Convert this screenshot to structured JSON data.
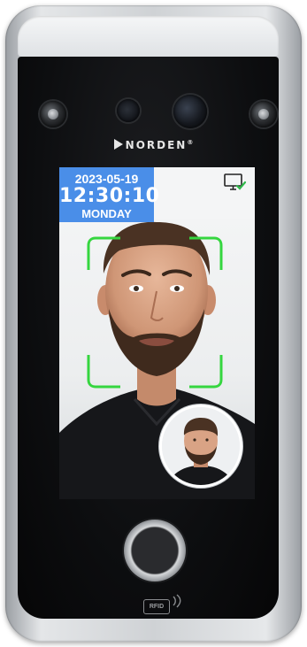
{
  "device": {
    "brand": "NORDEN",
    "brand_mark": "®",
    "rfid_label": "RFID"
  },
  "screen": {
    "date": "2023-05-19",
    "time": "12:30:10",
    "day": "MONDAY",
    "status_icon": "monitor-check-icon"
  },
  "colors": {
    "clock_bg": "#4a8ee8",
    "focus_frame": "#35d63f",
    "status_check": "#2fb84a"
  }
}
